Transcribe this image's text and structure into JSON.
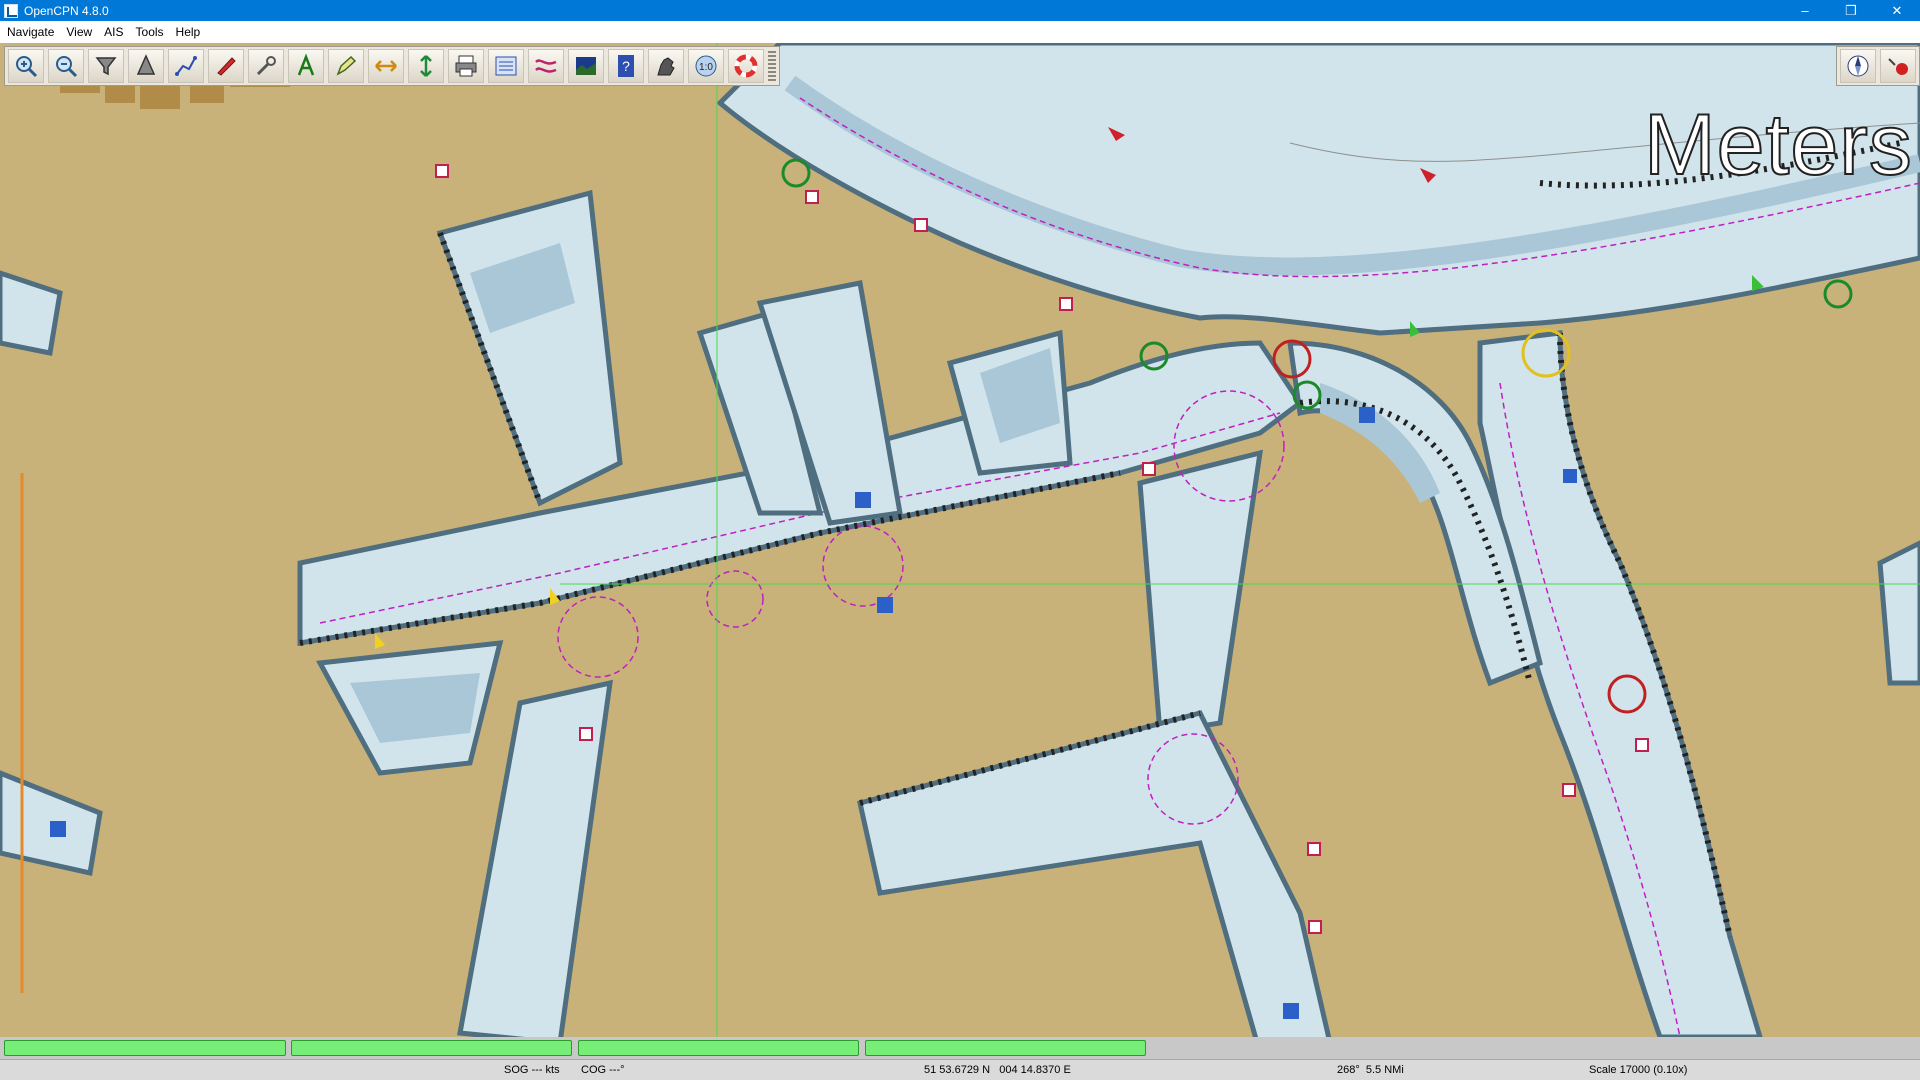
{
  "window": {
    "title": "OpenCPN 4.8.0",
    "minimize": "–",
    "restore": "❐",
    "close": "✕"
  },
  "menu": {
    "items": [
      "Navigate",
      "View",
      "AIS",
      "Tools",
      "Help"
    ]
  },
  "toolbar": {
    "tools": [
      {
        "name": "zoom-in",
        "icon": "zoom-in-icon"
      },
      {
        "name": "zoom-out",
        "icon": "zoom-out-icon"
      },
      {
        "name": "scale-in",
        "icon": "funnel-icon"
      },
      {
        "name": "scale-out",
        "icon": "scale-out-icon"
      },
      {
        "name": "route",
        "icon": "route-icon"
      },
      {
        "name": "auto-follow",
        "icon": "boat-icon"
      },
      {
        "name": "settings",
        "icon": "wrench-icon"
      },
      {
        "name": "text",
        "icon": "text-a-icon"
      },
      {
        "name": "current",
        "icon": "pen-icon"
      },
      {
        "name": "tide",
        "icon": "arrows-horizontal-icon"
      },
      {
        "name": "route-manager",
        "icon": "arrows-vertical-icon"
      },
      {
        "name": "print",
        "icon": "printer-icon"
      },
      {
        "name": "track",
        "icon": "checklist-icon"
      },
      {
        "name": "colorscheme",
        "icon": "wave-icon"
      },
      {
        "name": "chart-quilt",
        "icon": "landscape-icon"
      },
      {
        "name": "help",
        "icon": "help-book-icon"
      },
      {
        "name": "ais",
        "icon": "dog-icon"
      },
      {
        "name": "north-up",
        "icon": "scale-badge-icon",
        "label": "1:0"
      },
      {
        "name": "mob",
        "icon": "lifebuoy-icon"
      }
    ]
  },
  "right_toolbar": {
    "tools": [
      {
        "name": "compass",
        "icon": "compass-icon"
      },
      {
        "name": "gps-status",
        "icon": "gps-status-icon"
      }
    ]
  },
  "overlay": {
    "units_label": "Meters"
  },
  "progress": {
    "values": [
      1,
      1,
      1,
      1
    ]
  },
  "status": {
    "sog": "SOG --- kts",
    "cog": "COG ---°",
    "position": "51 53.6729 N   004 14.8370 E",
    "bearing_distance": "268°  5.5 NMi",
    "scale": "Scale 17000 (0.10x)"
  },
  "colors": {
    "land": "#c9b27a",
    "water": "#d1e4ec",
    "shallow": "#a9c7d7",
    "magenta": "#c020c0",
    "accent": "#0078d7"
  }
}
